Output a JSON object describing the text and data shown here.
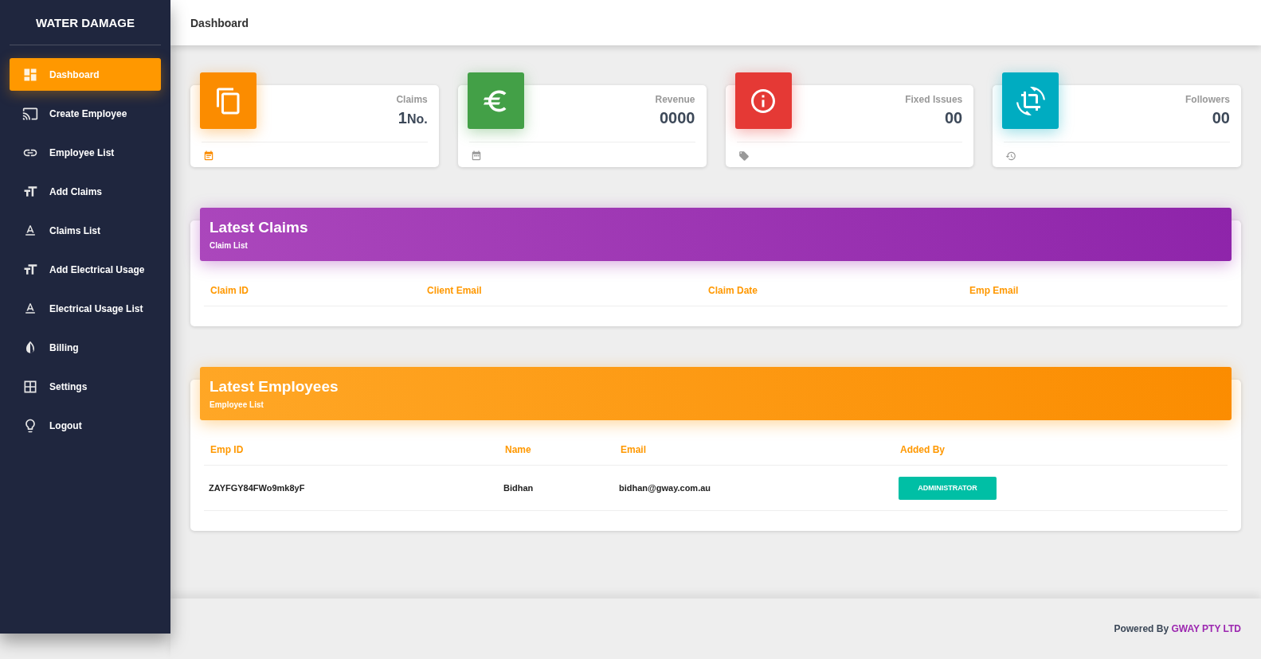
{
  "sidebar": {
    "brand": "WATER DAMAGE",
    "items": [
      {
        "label": "Dashboard",
        "selected": true
      },
      {
        "label": "Create Employee",
        "selected": false
      },
      {
        "label": "Employee List",
        "selected": false
      },
      {
        "label": "Add Claims",
        "selected": false
      },
      {
        "label": "Claims List",
        "selected": false
      },
      {
        "label": "Add Electrical Usage",
        "selected": false
      },
      {
        "label": "Electrical Usage List",
        "selected": false
      },
      {
        "label": "Billing",
        "selected": false
      },
      {
        "label": "Settings",
        "selected": false
      },
      {
        "label": "Logout",
        "selected": false
      }
    ]
  },
  "topbar": {
    "title": "Dashboard"
  },
  "stats": [
    {
      "label": "Claims",
      "value": "1",
      "unit": "No.",
      "color": "#fb8c00"
    },
    {
      "label": "Revenue",
      "value": "0000",
      "color": "#43a047"
    },
    {
      "label": "Fixed Issues",
      "value": "00",
      "color": "#e53935"
    },
    {
      "label": "Followers",
      "value": "00",
      "color": "#00acc1"
    }
  ],
  "tables": [
    {
      "title": "Latest Claims",
      "subtitle": "Claim List",
      "columns": [
        "Claim ID",
        "Client Email",
        "Claim Date",
        "Emp Email"
      ]
    },
    {
      "title": "Latest Employees",
      "subtitle": "Employee List",
      "columns": [
        "Emp ID",
        "Name",
        "Email",
        "Added By"
      ],
      "rows": [
        {
          "cells": [
            {
              "kind": "text",
              "text": "ZAYFGY84FWo9mk8yF"
            },
            {
              "kind": "text",
              "text": "Bidhan"
            },
            {
              "kind": "text",
              "text": "bidhan@gway.com.au"
            },
            {
              "kind": "badge",
              "text": "ADMINISTRATOR"
            }
          ]
        }
      ]
    }
  ],
  "footer": {
    "prefix": "Powered By",
    "company": "GWAY PTY LTD"
  }
}
